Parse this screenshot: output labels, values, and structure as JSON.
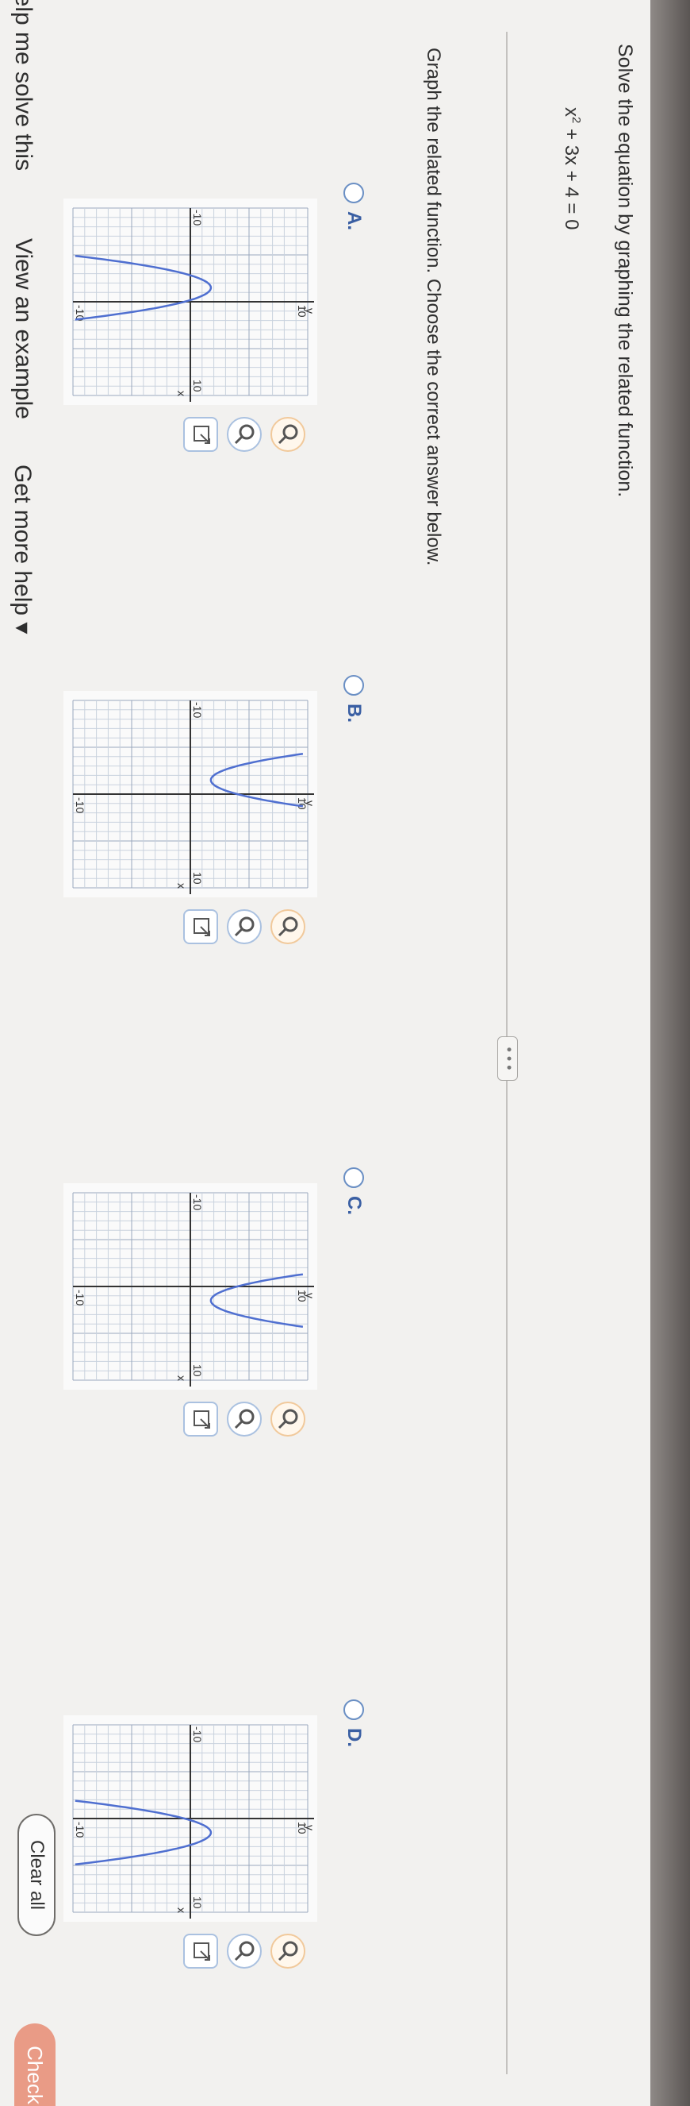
{
  "problem": {
    "instruction": "Solve the equation by graphing the related function.",
    "equation_base": "x",
    "equation_exponent": "2",
    "equation_rest": "+ 3x + 4 = 0",
    "ellipsis": "• • •",
    "question": "Graph the related function. Choose the correct answer below."
  },
  "options": [
    {
      "label": "A.",
      "vertex": [
        -1.5,
        1.75
      ],
      "a": -1,
      "icons": [
        "zoom-in-icon",
        "zoom-out-icon",
        "expand-icon"
      ]
    },
    {
      "label": "B.",
      "vertex": [
        -1.5,
        1.75
      ],
      "a": 1,
      "icons": [
        "zoom-in-icon",
        "zoom-out-icon",
        "expand-icon"
      ]
    },
    {
      "label": "C.",
      "vertex": [
        1.5,
        1.75
      ],
      "a": 1,
      "icons": [
        "zoom-in-icon",
        "zoom-out-icon",
        "expand-icon"
      ]
    },
    {
      "label": "D.",
      "vertex": [
        1.5,
        1.75
      ],
      "a": -1,
      "icons": [
        "zoom-in-icon",
        "zoom-out-icon",
        "expand-icon"
      ]
    }
  ],
  "graph": {
    "tick_min_label": "-10",
    "tick_max_label": "10",
    "axis_x": "x",
    "axis_y": "y",
    "range": [
      -10,
      10
    ]
  },
  "footer": {
    "help": "Help me solve this",
    "example": "View an example",
    "more": "Get more help ▾",
    "clear": "Clear all",
    "check": "Check"
  }
}
